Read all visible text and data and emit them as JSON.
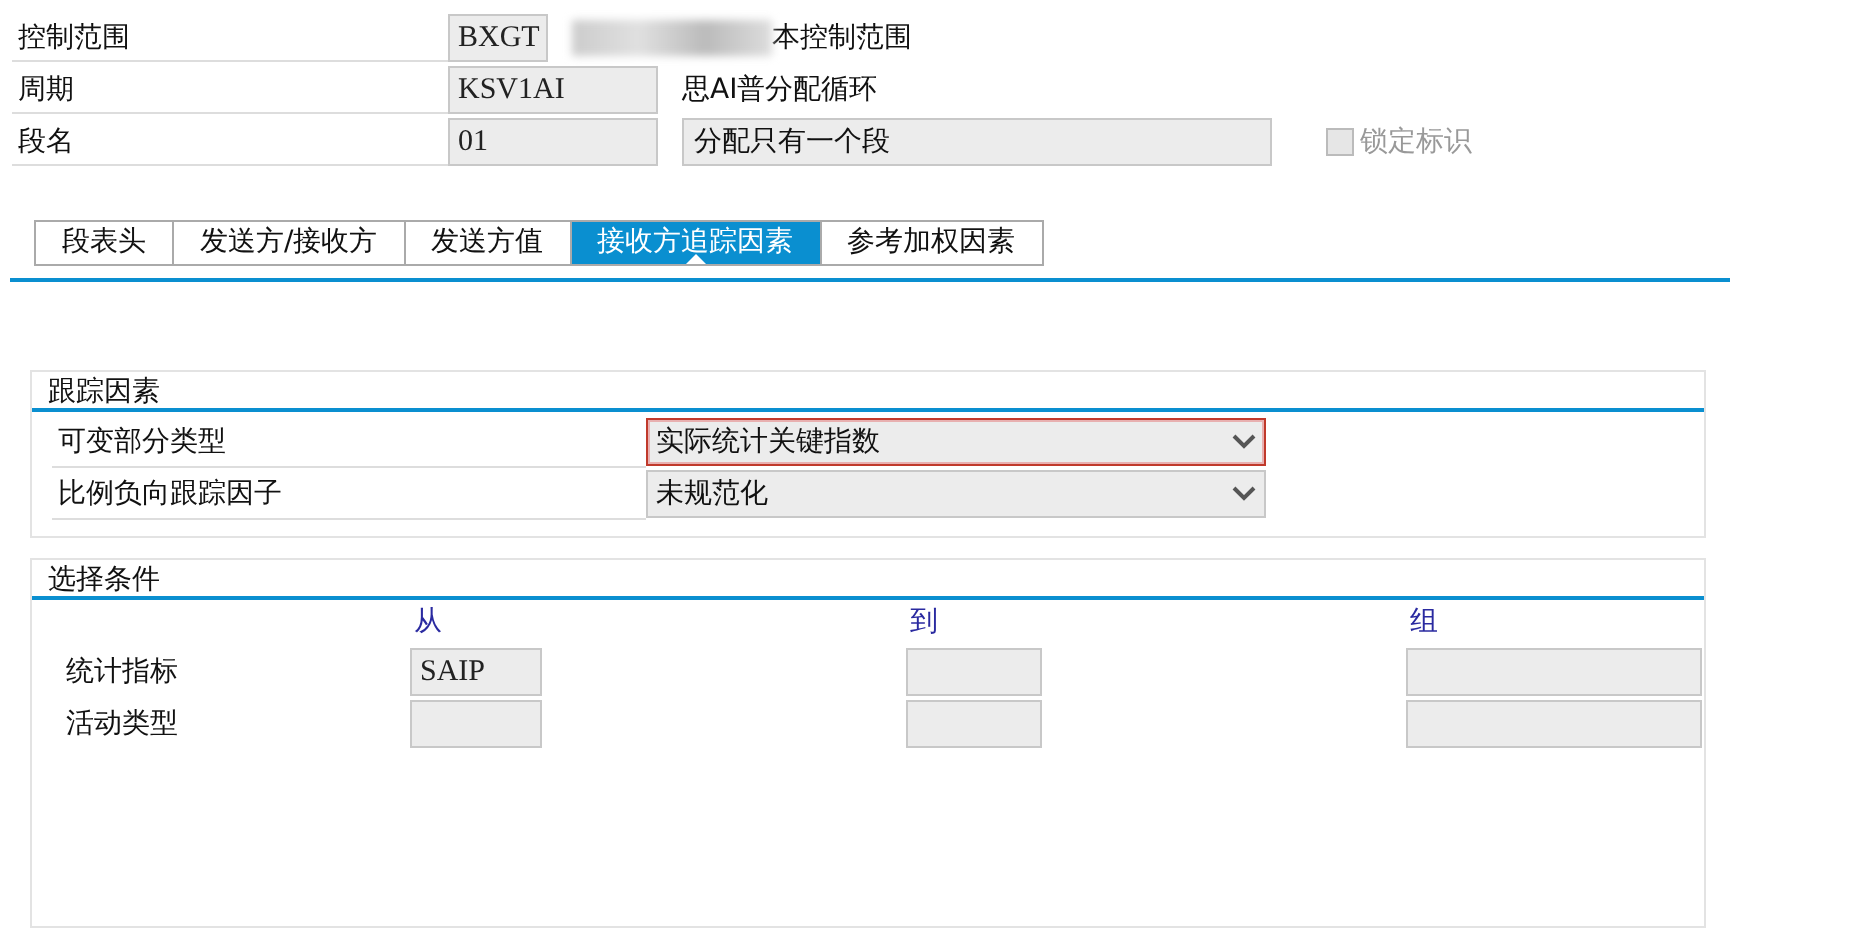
{
  "header": {
    "rows": [
      {
        "label": "控制范围",
        "value": "BXGT",
        "description": "本控制范围",
        "redacted": true
      },
      {
        "label": "周期",
        "value": "KSV1AI",
        "description": "思AI普分配循环"
      },
      {
        "label": "段名",
        "value": "01",
        "description_field": "分配只有一个段",
        "checkbox": {
          "label": "锁定标识",
          "checked": false,
          "disabled": true
        }
      }
    ]
  },
  "tabs": [
    {
      "label": "段表头",
      "selected": false
    },
    {
      "label": "发送方/接收方",
      "selected": false
    },
    {
      "label": "发送方值",
      "selected": false
    },
    {
      "label": "接收方追踪因素",
      "selected": true
    },
    {
      "label": "参考加权因素",
      "selected": false
    }
  ],
  "tracing_group": {
    "title": "跟踪因素",
    "rows": [
      {
        "label": "可变部分类型",
        "value": "实际统计关键指数",
        "focused": true
      },
      {
        "label": "比例负向跟踪因子",
        "value": "未规范化",
        "focused": false
      }
    ]
  },
  "selection_group": {
    "title": "选择条件",
    "columns": [
      "从",
      "到",
      "组"
    ],
    "rows": [
      {
        "label": "统计指标",
        "values": [
          "SAIP"
        ]
      },
      {
        "label": "活动类型"
      }
    ]
  }
}
